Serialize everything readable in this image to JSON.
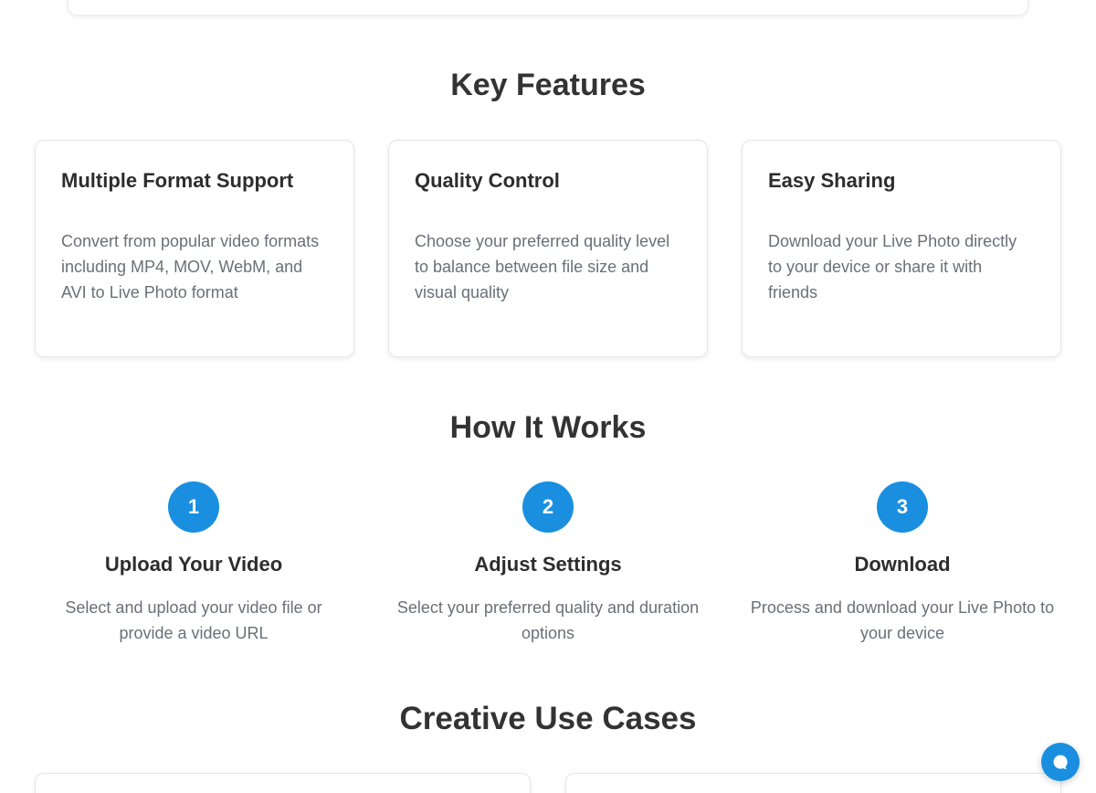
{
  "sections": {
    "key_features_title": "Key Features",
    "how_it_works_title": "How It Works",
    "creative_use_cases_title": "Creative Use Cases"
  },
  "features": [
    {
      "title": "Multiple Format Support",
      "description": "Convert from popular video formats including MP4, MOV, WebM, and AVI to Live Photo format"
    },
    {
      "title": "Quality Control",
      "description": "Choose your preferred quality level to balance between file size and visual quality"
    },
    {
      "title": "Easy Sharing",
      "description": "Download your Live Photo directly to your device or share it with friends"
    }
  ],
  "steps": [
    {
      "number": "1",
      "title": "Upload Your Video",
      "description": "Select and upload your video file or provide a video URL"
    },
    {
      "number": "2",
      "title": "Adjust Settings",
      "description": "Select your preferred quality and duration options"
    },
    {
      "number": "3",
      "title": "Download",
      "description": "Process and download your Live Photo to your device"
    }
  ],
  "chat": {
    "icon": "chat-bubble-icon"
  },
  "colors": {
    "accent": "#1a8fe0",
    "heading": "#333333",
    "body_text": "#6b6f76"
  }
}
